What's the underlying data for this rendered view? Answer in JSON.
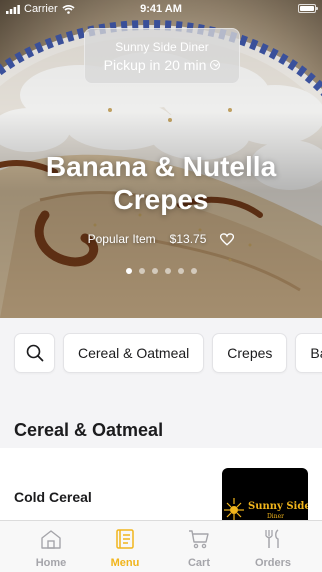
{
  "status_bar": {
    "carrier": "Carrier",
    "time": "9:41 AM"
  },
  "restaurant": {
    "name": "Sunny Side Diner",
    "pickup": "Pickup in 20 min"
  },
  "hero": {
    "title": "Banana & Nutella Crepes",
    "tag": "Popular Item",
    "price": "$13.75",
    "slides_total": 6,
    "active_slide": 1
  },
  "categories": {
    "search_icon": "search-icon",
    "items": [
      "Cereal & Oatmeal",
      "Crepes",
      "Ba"
    ]
  },
  "menu": {
    "section_title": "Cereal & Oatmeal",
    "items": [
      {
        "name": "Cold Cereal",
        "image_text": "Sunny Side",
        "image_subtext": "Diner"
      }
    ]
  },
  "tabs": [
    {
      "label": "Home",
      "icon": "home-icon"
    },
    {
      "label": "Menu",
      "icon": "menu-icon",
      "active": true
    },
    {
      "label": "Cart",
      "icon": "cart-icon"
    },
    {
      "label": "Orders",
      "icon": "orders-icon"
    }
  ],
  "colors": {
    "accent": "#f1b51c",
    "tab_inactive": "#a5a5aa",
    "background": "#f4f4f6"
  }
}
